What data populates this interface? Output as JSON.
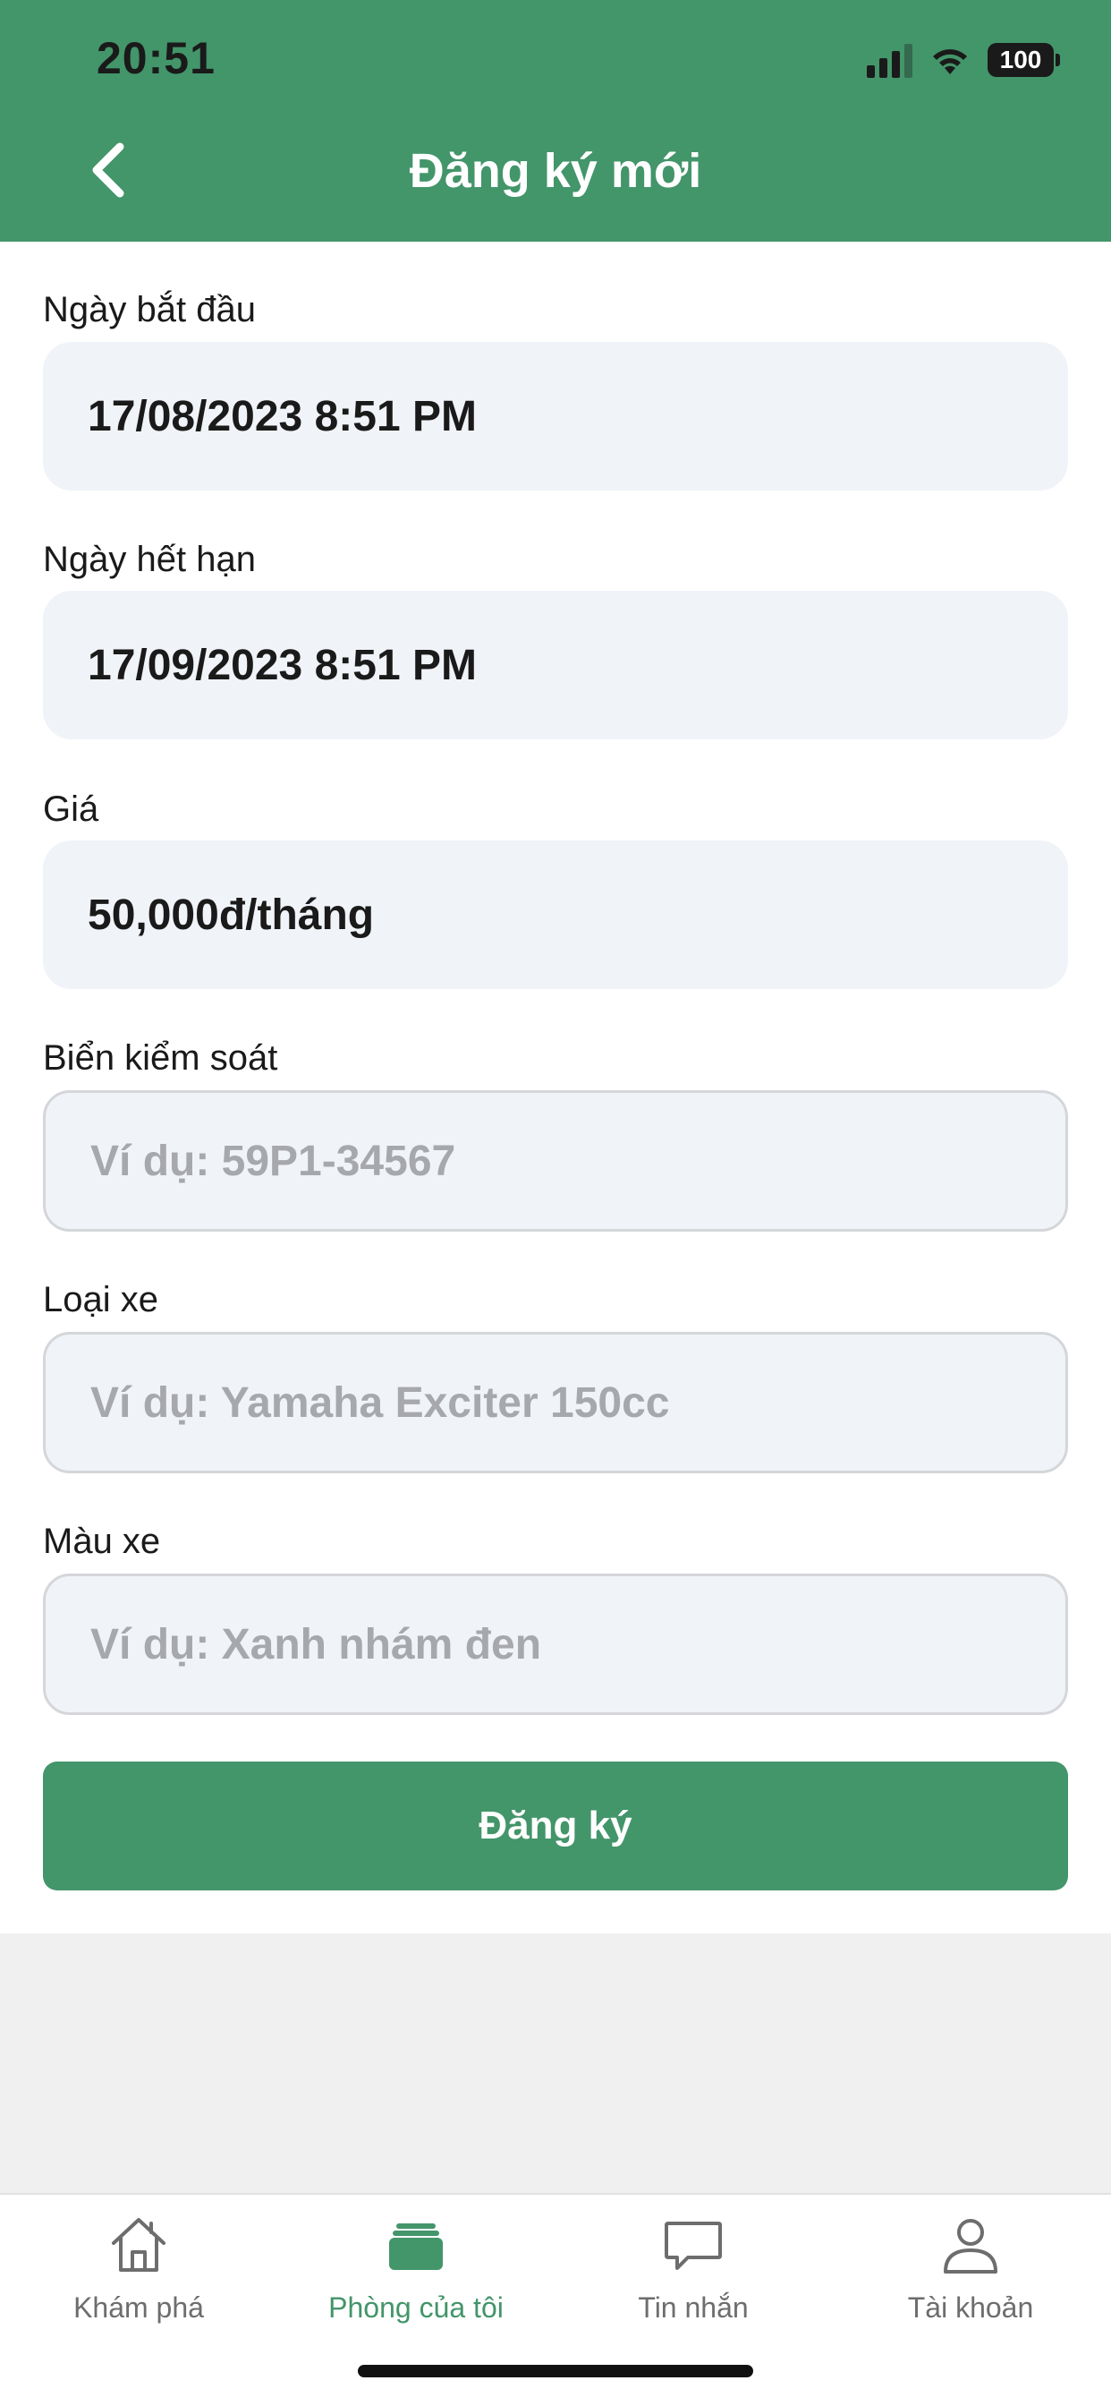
{
  "status_bar": {
    "time": "20:51",
    "battery": "100"
  },
  "header": {
    "title": "Đăng ký mới",
    "back_icon": "chevron-left-icon"
  },
  "form": {
    "start_date": {
      "label": "Ngày bắt đầu",
      "value": "17/08/2023 8:51 PM"
    },
    "end_date": {
      "label": "Ngày hết hạn",
      "value": "17/09/2023 8:51 PM"
    },
    "price": {
      "label": "Giá",
      "value": "50,000đ/tháng"
    },
    "plate": {
      "label": "Biển kiểm soát",
      "value": "",
      "placeholder": "Ví dụ: 59P1-34567"
    },
    "vehicle_type": {
      "label": "Loại xe",
      "value": "",
      "placeholder": "Ví dụ: Yamaha Exciter 150cc"
    },
    "vehicle_color": {
      "label": "Màu xe",
      "value": "",
      "placeholder": "Ví dụ: Xanh nhám đen"
    },
    "submit_label": "Đăng ký"
  },
  "tabbar": {
    "items": [
      {
        "label": "Khám phá",
        "icon": "home-icon",
        "active": false
      },
      {
        "label": "Phòng của tôi",
        "icon": "stack-icon",
        "active": true
      },
      {
        "label": "Tin nhắn",
        "icon": "chat-bubble-icon",
        "active": false
      },
      {
        "label": "Tài khoản",
        "icon": "user-icon",
        "active": false
      }
    ]
  },
  "colors": {
    "primary": "#43956a",
    "field_bg": "#f0f3f8",
    "placeholder": "#a6a8ab",
    "page_bg": "#f0f0f0"
  }
}
